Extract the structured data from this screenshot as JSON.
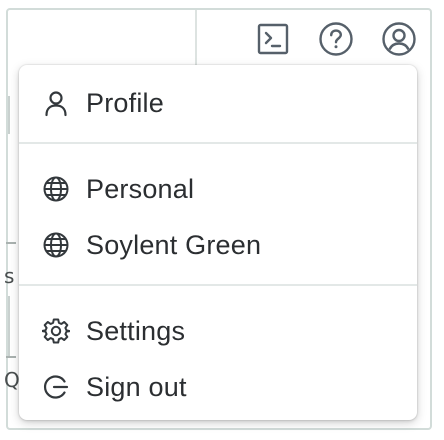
{
  "toolbar": {
    "icons": [
      "terminal-icon",
      "help-icon",
      "user-account-icon"
    ]
  },
  "background": {
    "fragment_s": "s",
    "fragment_q": "Q"
  },
  "menu": {
    "items": [
      {
        "label": "Profile",
        "icon": "user-icon"
      },
      {
        "label": "Personal",
        "icon": "globe-icon"
      },
      {
        "label": "Soylent Green",
        "icon": "globe-icon"
      },
      {
        "label": "Settings",
        "icon": "gear-icon"
      },
      {
        "label": "Sign out",
        "icon": "sign-out-icon"
      }
    ]
  },
  "colors": {
    "icon": "#56606a",
    "text": "#2b2e31",
    "separator": "#e3e8e7",
    "frame_border": "#d2dcd9"
  }
}
